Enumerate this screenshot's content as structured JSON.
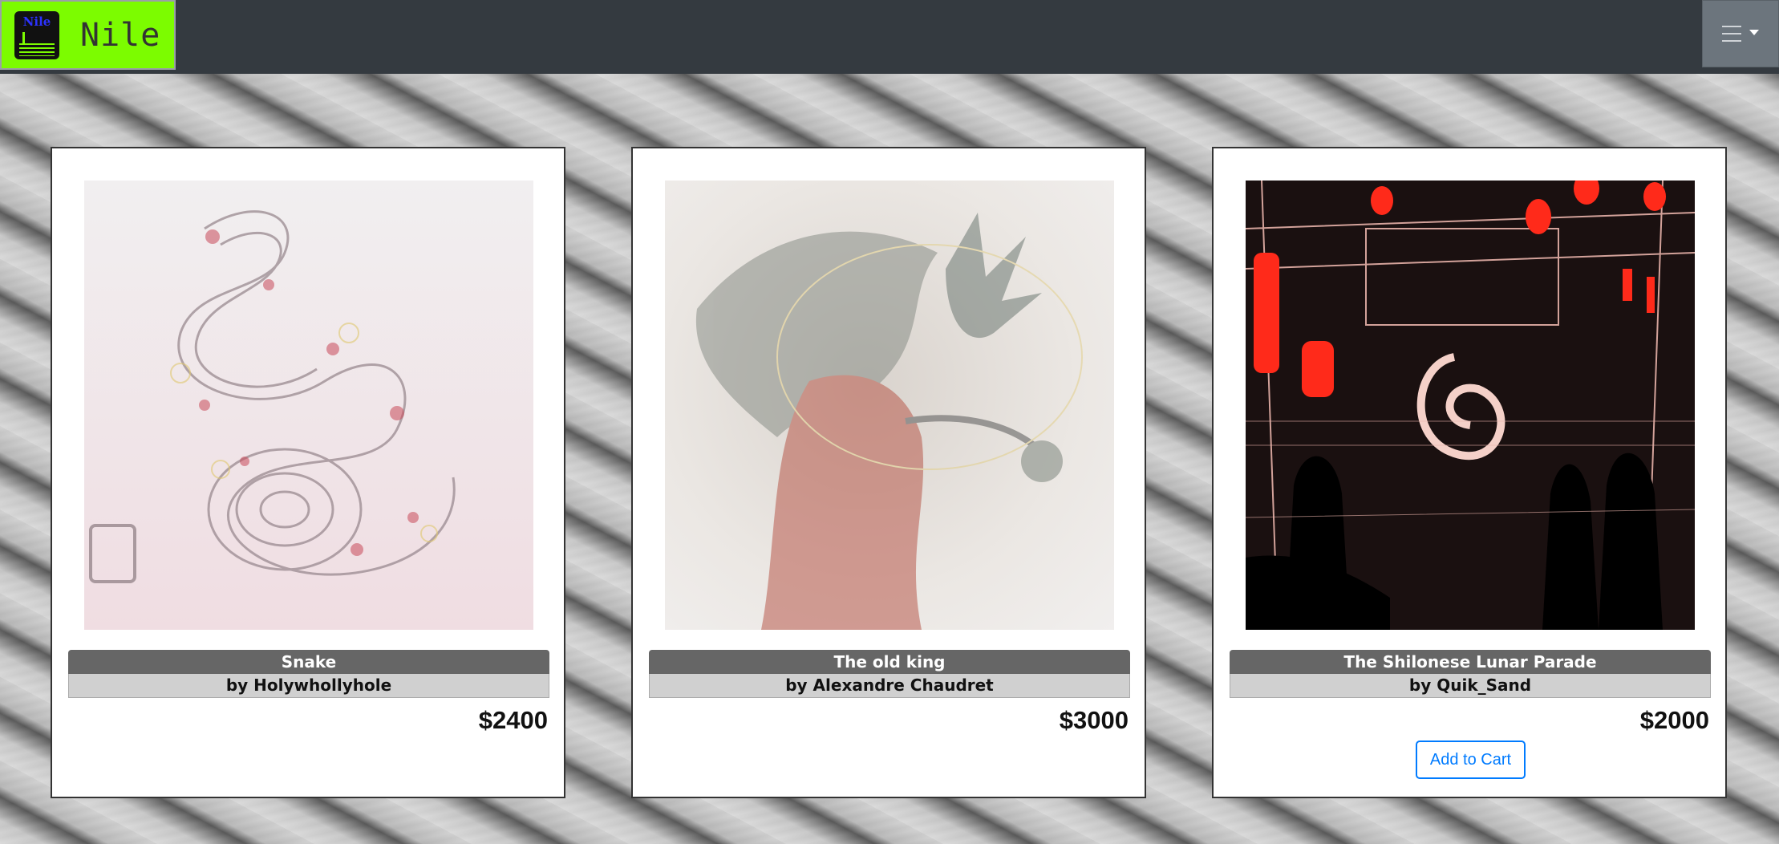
{
  "brand": {
    "name": "Nile",
    "logo_text": "Nile",
    "accent": "#7cfc00"
  },
  "navbar": {
    "background": "#343a40",
    "menu_icon": "hamburger-icon"
  },
  "products": [
    {
      "title": "Snake",
      "artist": "by Holywhollyhole",
      "price": "$2400",
      "image": "snake-artwork"
    },
    {
      "title": "The old king",
      "artist": "by Alexandre Chaudret",
      "price": "$3000",
      "image": "old-king-artwork"
    },
    {
      "title": "The Shilonese Lunar Parade",
      "artist": "by Quik_Sand",
      "price": "$2000",
      "image": "lunar-parade-artwork",
      "button_label": "Add to Cart"
    }
  ],
  "colors": {
    "button": "#007bff",
    "title_bar": "#666666",
    "artist_bar": "#d0d0d0"
  }
}
